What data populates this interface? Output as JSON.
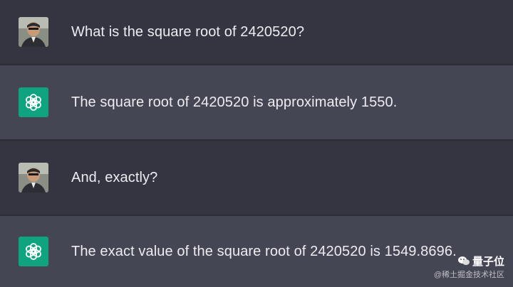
{
  "messages": [
    {
      "role": "user",
      "avatar": "user-avatar",
      "text": "What is the square root of 2420520?"
    },
    {
      "role": "assistant",
      "avatar": "chatgpt-logo-icon",
      "text": "The square root of 2420520 is approximately 1550."
    },
    {
      "role": "user",
      "avatar": "user-avatar",
      "text": "And, exactly?"
    },
    {
      "role": "assistant",
      "avatar": "chatgpt-logo-icon",
      "text": "The exact value of the square root of 2420520 is 1549.8696."
    }
  ],
  "watermark": {
    "brand": "量子位",
    "source": "@稀土掘金技术社区"
  },
  "colors": {
    "user_bg": "#343541",
    "assistant_bg": "#444654",
    "gpt_green": "#10a37f",
    "text": "#ececf1"
  }
}
